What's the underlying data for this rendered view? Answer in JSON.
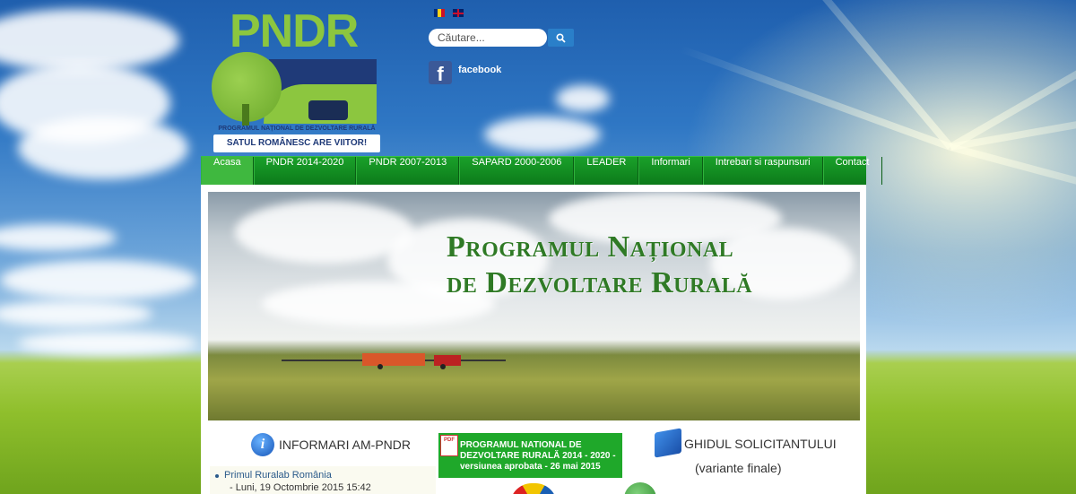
{
  "header": {
    "logo": {
      "title": "PNDR",
      "subtitle": "PROGRAMUL NAȚIONAL DE DEZVOLTARE RURALĂ",
      "tagline": "SATUL ROMÂNESC ARE VIITOR!"
    },
    "languages": [
      "ro",
      "en"
    ],
    "search": {
      "placeholder": "Căutare..."
    },
    "social": {
      "facebook_label": "facebook"
    }
  },
  "nav": {
    "items": [
      {
        "label": "Acasa",
        "active": true
      },
      {
        "label": "PNDR 2014-2020"
      },
      {
        "label": "PNDR 2007-2013"
      },
      {
        "label": "SAPARD 2000-2006"
      },
      {
        "label": "LEADER"
      },
      {
        "label": "Informari"
      },
      {
        "label": "Intrebari si raspunsuri"
      },
      {
        "label": "Contact"
      }
    ]
  },
  "banner": {
    "line1": "Programul Național",
    "line2": "de Dezvoltare Rurală"
  },
  "columns": {
    "informari": {
      "title": "INFORMARI AM-PNDR",
      "items": [
        {
          "title": "Primul Ruralab România",
          "date": "- Luni, 19 Octombrie 2015 15:42"
        }
      ]
    },
    "promo": {
      "text": "PROGRAMUL NATIONAL DE DEZVOLTARE RURALĂ 2014 - 2020 - versiunea aprobata - 26 mai 2015"
    },
    "ghid": {
      "title": "GHIDUL SOLICITANTULUI",
      "subtitle": "(variante finale)"
    }
  },
  "colors": {
    "nav_green": "#1aa12a",
    "nav_active": "#3fb83f",
    "logo_green": "#8cc63f",
    "logo_blue": "#1f3a78",
    "banner_title": "#2f7a25"
  }
}
